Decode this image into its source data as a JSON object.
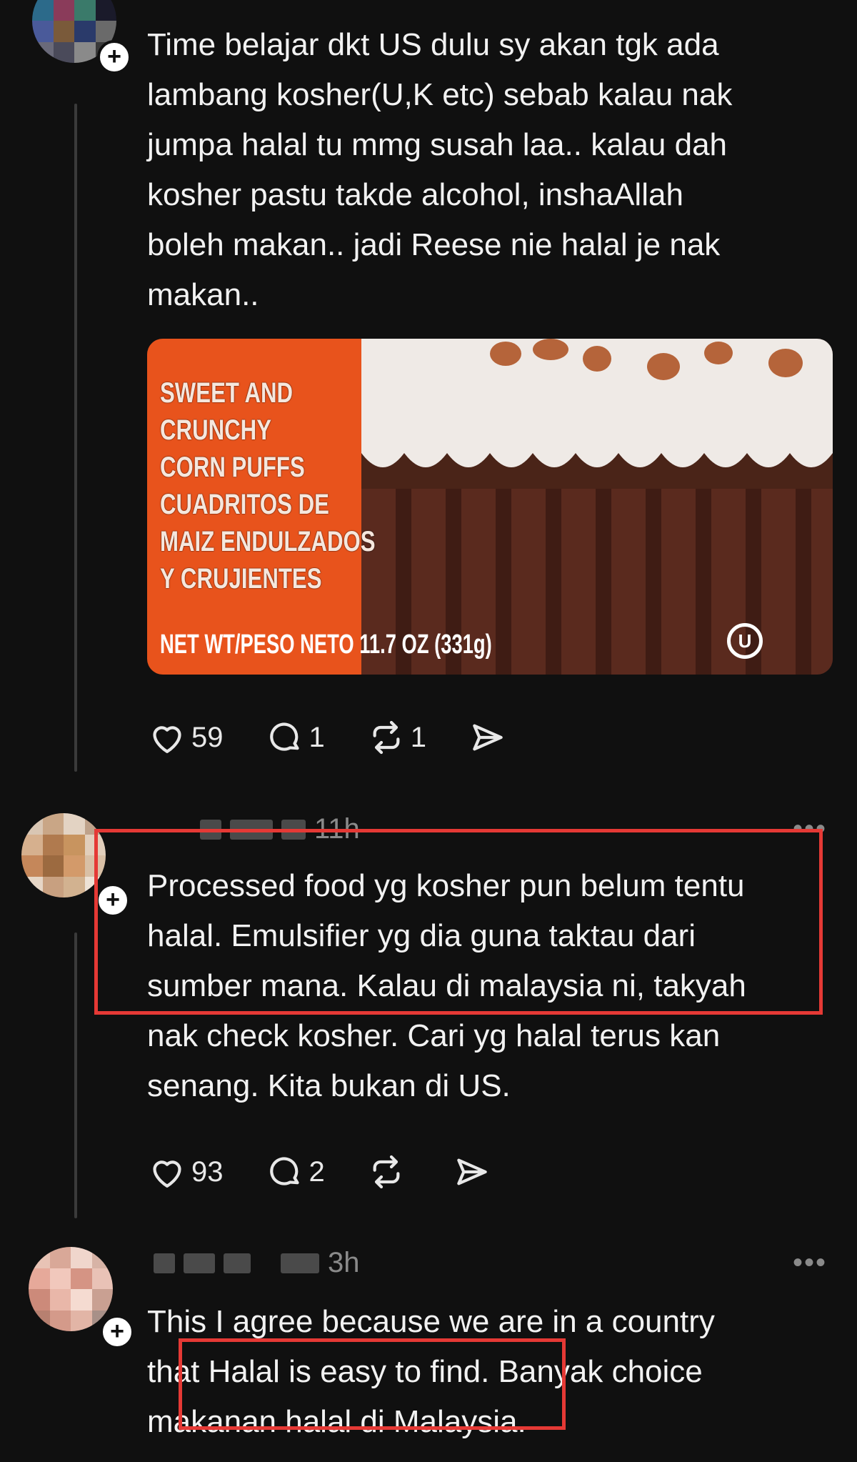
{
  "colors": {
    "background": "#101010",
    "text": "#f2f2f2",
    "muted": "#8a8a8a",
    "highlight": "#e53935"
  },
  "posts": [
    {
      "text": "Time belajar dkt US dulu sy akan tgk ada\nlambang kosher(U,K etc) sebab kalau nak\njumpa halal tu mmg susah laa.. kalau dah\nkosher pastu takde alcohol, inshaAllah\nboleh makan.. jadi Reese nie halal je nak\nmakan..",
      "media": {
        "pack_text": "SWEET AND\nCRUNCHY\nCORN PUFFS\nCUADRITOS DE\nMAIZ ENDULZADOS\nY CRUJIENTES",
        "net_wt": "NET WT/PESO NETO 11.7 OZ (331g)",
        "kosher_symbol": "U"
      },
      "likes": "59",
      "replies": "1",
      "reposts": "1"
    },
    {
      "time": "11h",
      "text": "Processed food yg kosher pun belum tentu\nhalal. Emulsifier yg dia guna taktau dari\nsumber mana. Kalau di malaysia ni, takyah\nnak check kosher. Cari yg halal terus kan\nsenang. Kita bukan di US.",
      "likes": "93",
      "replies": "2"
    },
    {
      "time": "3h",
      "text": "This I agree because we are in a country\nthat Halal is easy to find. Banyak choice\nmakanan halal di Malaysia."
    }
  ],
  "icons": {
    "like": "heart-icon",
    "reply": "comment-icon",
    "repost": "repost-icon",
    "share": "send-icon",
    "more": "more-dots-icon",
    "follow": "plus-icon"
  },
  "more_glyph": "•••",
  "plus_glyph": "+"
}
